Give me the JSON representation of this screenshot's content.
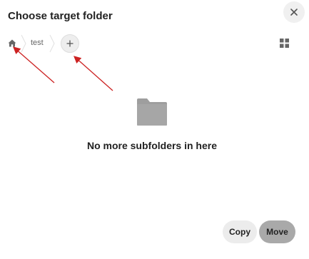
{
  "dialog": {
    "title": "Choose target folder",
    "close_icon": "close-icon"
  },
  "breadcrumb": {
    "home_icon": "home-icon",
    "items": [
      "test"
    ],
    "add_icon": "plus-icon"
  },
  "view_toggle_icon": "grid-view-icon",
  "empty_state": {
    "icon": "folder-icon",
    "message": "No more subfolders in here"
  },
  "actions": {
    "copy_label": "Copy",
    "move_label": "Move"
  },
  "colors": {
    "annotation_arrow": "#cc2222",
    "folder": "#9e9e9e",
    "move_button": "#a9a9a9",
    "copy_button": "#ececec"
  }
}
